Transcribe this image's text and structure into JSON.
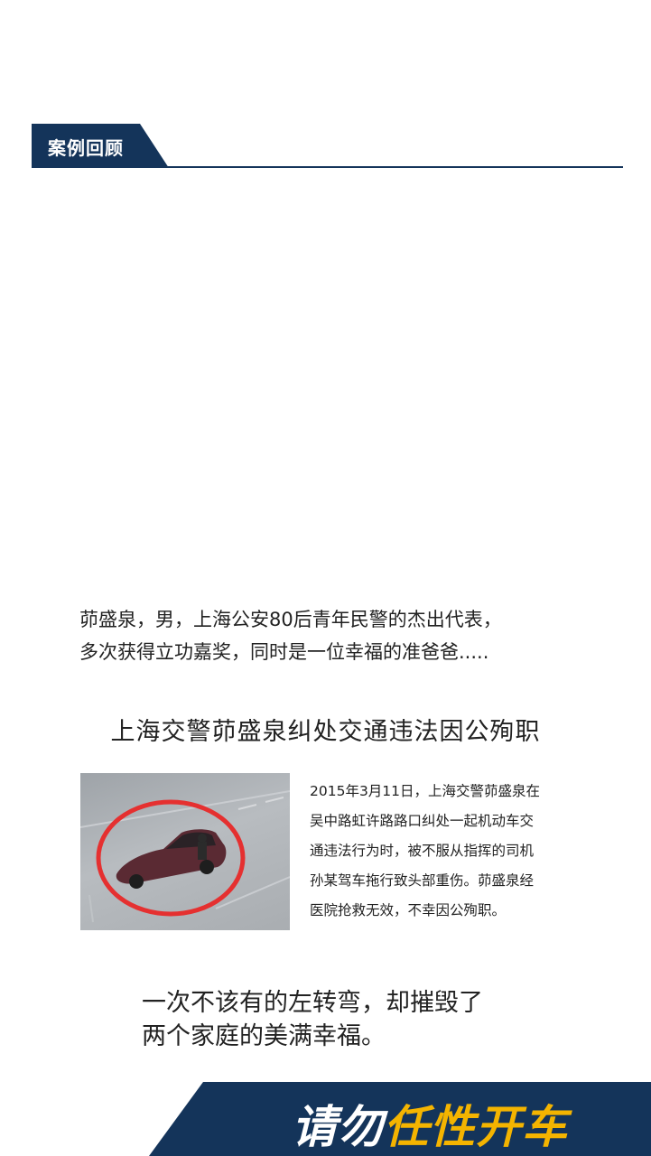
{
  "section": {
    "title": "案例回顾"
  },
  "intro": {
    "line1": "茆盛泉，男，上海公安80后青年民警的杰出代表，",
    "line2": "多次获得立功嘉奖，同时是一位幸福的准爸爸....."
  },
  "headline": "上海交警茆盛泉纠处交通违法因公殉职",
  "case": {
    "lines": [
      "2015年3月11日，上海交警茆盛泉在",
      "吴中路虹许路路口纠处一起机动车交",
      "通违法行为时，被不服从指挥的司机",
      "孙某驾车拖行致头部重伤。茆盛泉经",
      "医院抢救无效，不幸因公殉职。"
    ]
  },
  "reflection": {
    "line1": "一次不该有的左转弯，却摧毁了",
    "line2": "两个家庭的美满幸福。"
  },
  "banner": {
    "slogan_part1": "请勿",
    "slogan_part2": "任性开车"
  },
  "colors": {
    "navy": "#14345a",
    "accent_yellow": "#f4b400",
    "highlight_circle": "#e53030"
  },
  "icons": [
    "cctv-car-photo"
  ]
}
